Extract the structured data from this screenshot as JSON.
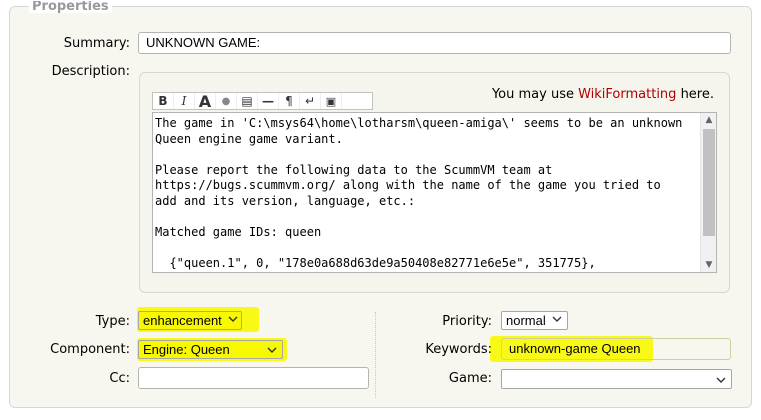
{
  "legend": "Properties",
  "summary": {
    "label": "Summary:",
    "value": "UNKNOWN GAME:"
  },
  "description": {
    "label": "Description:",
    "hint_prefix": "You may use ",
    "hint_link": "WikiFormatting",
    "hint_suffix": " here.",
    "toolbar": [
      "B",
      "I",
      "A",
      "●",
      "▤",
      "—",
      "¶",
      "↵",
      "▣"
    ],
    "text": "The game in 'C:\\msys64\\home\\lotharsm\\queen-amiga\\' seems to be an unknown\nQueen engine game variant.\n\nPlease report the following data to the ScummVM team at\nhttps://bugs.scummvm.org/ along with the name of the game you tried to\nadd and its version, language, etc.:\n\nMatched game IDs: queen\n\n  {\"queen.1\", 0, \"178e0a688d63de9a50408e82771e6e5e\", 351775},"
  },
  "type": {
    "label": "Type:",
    "value": "enhancement"
  },
  "component": {
    "label": "Component:",
    "value": "Engine: Queen"
  },
  "cc": {
    "label": "Cc:",
    "value": ""
  },
  "priority": {
    "label": "Priority:",
    "value": "normal"
  },
  "keywords": {
    "label": "Keywords:",
    "value": "unknown-game Queen"
  },
  "game": {
    "label": "Game:",
    "value": ""
  },
  "colors": {
    "highlight": "#f8f800",
    "link": "#b00000"
  }
}
